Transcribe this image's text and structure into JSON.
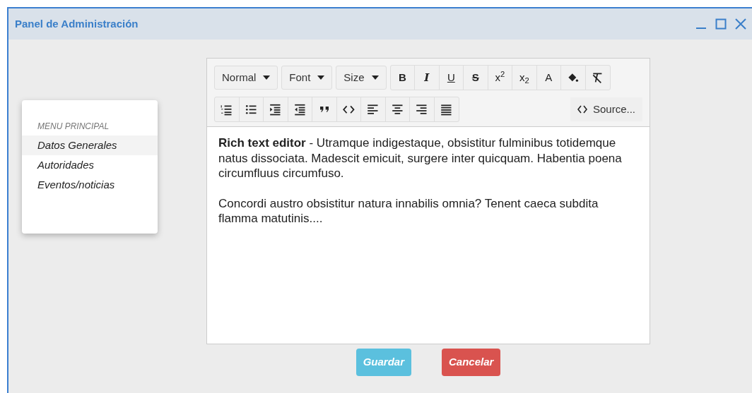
{
  "window": {
    "title": "Panel de Administración"
  },
  "menu": {
    "heading": "MENU PRINCIPAL",
    "items": [
      {
        "label": "Datos Generales",
        "selected": true
      },
      {
        "label": "Autoridades",
        "selected": false
      },
      {
        "label": "Eventos/noticias",
        "selected": false
      }
    ]
  },
  "toolbar": {
    "rows": [
      [
        {
          "kind": "dropdown",
          "label": "Normal"
        },
        {
          "kind": "dropdown",
          "label": "Font"
        },
        {
          "kind": "dropdown",
          "label": "Size"
        },
        {
          "kind": "group",
          "buttons": [
            {
              "kind": "char",
              "label": "B"
            },
            {
              "kind": "char",
              "label": "I"
            },
            {
              "kind": "char",
              "label": "U"
            },
            {
              "kind": "char",
              "label": "S"
            },
            {
              "kind": "char",
              "label": "x$^{2}$"
            },
            {
              "kind": "char",
              "label": "x$_{2}$"
            },
            {
              "kind": "char",
              "label": "A"
            },
            {
              "kind": "icon"
            },
            {
              "kind": "icon"
            }
          ]
        }
      ],
      [
        {
          "kind": "group",
          "buttons": [
            {
              "kind": "icon"
            },
            {
              "kind": "icon"
            },
            {
              "kind": "icon"
            },
            {
              "kind": "icon"
            },
            {
              "kind": "icon"
            },
            {
              "kind": "icon"
            },
            {
              "kind": "icon"
            },
            {
              "kind": "icon"
            },
            {
              "kind": "icon"
            },
            {
              "kind": "icon"
            }
          ]
        },
        {
          "kind": "source",
          "label": "Source..."
        }
      ]
    ]
  },
  "editor": {
    "paragraphs": [
      "**Rich text editor** - Utramque indigestaque, obsistitur fulminibus totidemque natus dissociata. Madescit emicuit, surgere inter quicquam. Habentia poena circumfluus circumfuso.",
      "Concordi austro obsistitur natura innabilis omnia? Tenent caeca subdita flamma matutinis...."
    ]
  },
  "buttons": [
    {
      "label": "Guardar",
      "kind": "info"
    },
    {
      "label": "Cancelar",
      "kind": "danger"
    }
  ]
}
